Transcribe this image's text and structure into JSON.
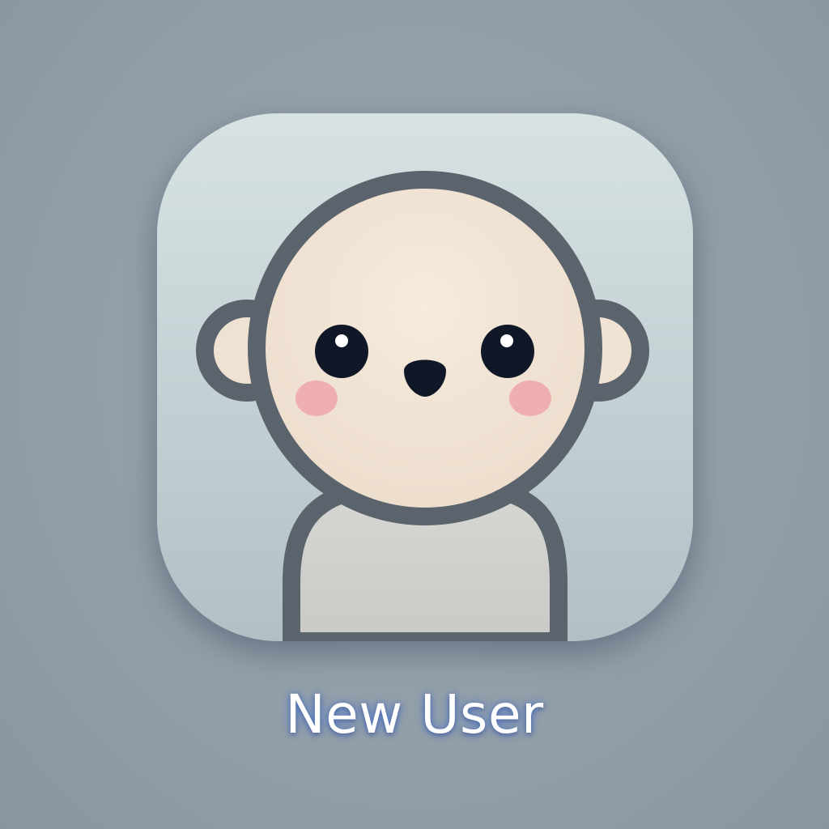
{
  "app": {
    "label": "New User",
    "icon_name": "user-avatar-icon"
  },
  "colors": {
    "background": "#95a1aa",
    "icon_tile_top": "#d8e2e3",
    "icon_tile_bottom": "#b2c0c6",
    "outline": "#5b646c",
    "face": "#f3e6d6",
    "body": "#d3d3ce",
    "cheeks": "#eea9ab",
    "eyes": "#101827",
    "label_text": "#ffffff",
    "label_glow": "#4678dc"
  }
}
